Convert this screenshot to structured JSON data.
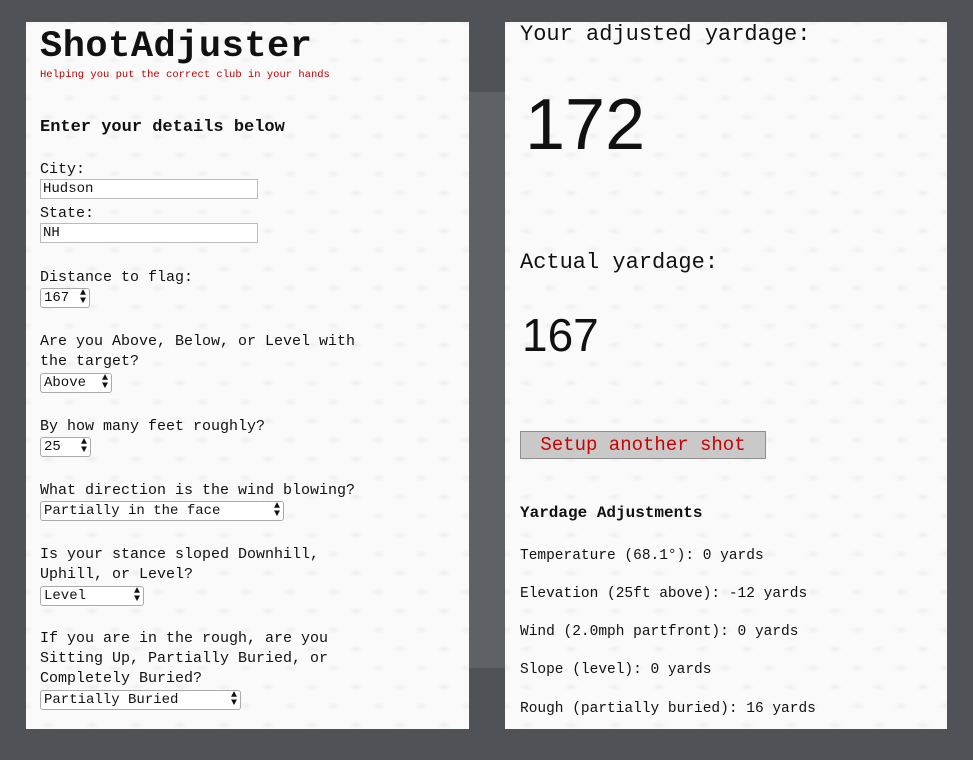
{
  "app": {
    "title": "ShotAdjuster",
    "tagline": "Helping you put the correct club in your hands"
  },
  "form": {
    "heading": "Enter your details below",
    "city_label": "City:",
    "city_value": "Hudson",
    "state_label": "State:",
    "state_value": "NH",
    "distance_label": "Distance to flag:",
    "distance_value": "167",
    "elevation_question": [
      "Are you Above, Below, or Level with",
      "the target?"
    ],
    "elevation_value": "Above",
    "feet_question": "By how many feet roughly?",
    "feet_value": "25",
    "wind_question": "What direction is the wind blowing?",
    "wind_value": "Partially in the face",
    "stance_question": [
      "Is your stance sloped Downhill,",
      "Uphill, or Level?"
    ],
    "stance_value": "Level",
    "rough_question": [
      "If you are in the rough, are you",
      "Sitting Up, Partially Buried, or",
      "Completely Buried?"
    ],
    "rough_value": "Partially Buried"
  },
  "results": {
    "adjusted_label": "Your adjusted yardage:",
    "adjusted_value": "172",
    "actual_label": "Actual yardage:",
    "actual_value": "167",
    "setup_button": "Setup another shot",
    "adjustments_heading": "Yardage Adjustments",
    "adjustments": [
      "Temperature (68.1°): 0 yards",
      "Elevation (25ft above): -12 yards",
      "Wind (2.0mph partfront): 0 yards",
      "Slope (level): 0 yards",
      "Rough (partially buried): 16 yards"
    ]
  },
  "colors": {
    "background": "#4f5257",
    "panel": "#fafafa",
    "accent_red": "#c00000",
    "button_bg": "#c9c9c9"
  },
  "icons": {
    "select_arrows": "up-down-chevron-icon"
  }
}
